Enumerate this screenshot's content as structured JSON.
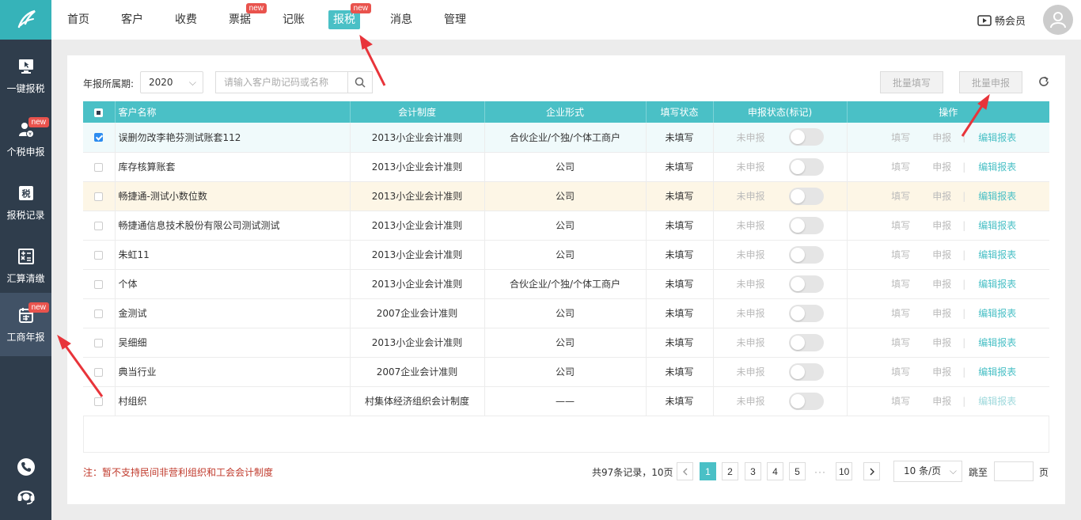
{
  "sidebar": {
    "items": [
      {
        "label": "一键报税",
        "icon": "monitor-cursor-icon",
        "badge": ""
      },
      {
        "label": "个税申报",
        "icon": "person-tax-icon",
        "badge": "new"
      },
      {
        "label": "报税记录",
        "icon": "tax-record-icon",
        "badge": ""
      },
      {
        "label": "汇算清缴",
        "icon": "calculator-icon",
        "badge": ""
      },
      {
        "label": "工商年报",
        "icon": "annual-report-icon",
        "badge": "new"
      }
    ],
    "bottom_icons": [
      "phone-icon",
      "headset-icon"
    ]
  },
  "topnav": {
    "items": [
      {
        "label": "首页",
        "badge": ""
      },
      {
        "label": "客户",
        "badge": ""
      },
      {
        "label": "收费",
        "badge": ""
      },
      {
        "label": "票据",
        "badge": "new"
      },
      {
        "label": "记账",
        "badge": ""
      },
      {
        "label": "报税",
        "badge": "new"
      },
      {
        "label": "消息",
        "badge": ""
      },
      {
        "label": "管理",
        "badge": ""
      }
    ],
    "member_label": "畅会员"
  },
  "filters": {
    "period_label": "年报所属期:",
    "year": "2020",
    "search_placeholder": "请输入客户助记码或名称"
  },
  "actions": {
    "batch_fill": "批量填写",
    "batch_declare": "批量申报"
  },
  "table": {
    "headers": {
      "name": "客户名称",
      "system": "会计制度",
      "form": "企业形式",
      "fill_status": "填写状态",
      "declare_status": "申报状态(标记)",
      "ops": "操作"
    },
    "op_labels": {
      "fill": "填写",
      "declare": "申报",
      "edit": "编辑报表"
    },
    "rows": [
      {
        "name": "误删勿改李艳芬测试账套112",
        "system": "2013小企业会计准则",
        "form": "合伙企业/个独/个体工商户",
        "fill": "未填写",
        "declare": "未申报"
      },
      {
        "name": "库存核算账套",
        "system": "2013小企业会计准则",
        "form": "公司",
        "fill": "未填写",
        "declare": "未申报"
      },
      {
        "name": "畅捷通-测试小数位数",
        "system": "2013小企业会计准则",
        "form": "公司",
        "fill": "未填写",
        "declare": "未申报"
      },
      {
        "name": "畅捷通信息技术股份有限公司测试测试",
        "system": "2013小企业会计准则",
        "form": "公司",
        "fill": "未填写",
        "declare": "未申报"
      },
      {
        "name": "朱虹11",
        "system": "2013小企业会计准则",
        "form": "公司",
        "fill": "未填写",
        "declare": "未申报"
      },
      {
        "name": "个体",
        "system": "2013小企业会计准则",
        "form": "合伙企业/个独/个体工商户",
        "fill": "未填写",
        "declare": "未申报"
      },
      {
        "name": "金测试",
        "system": "2007企业会计准则",
        "form": "公司",
        "fill": "未填写",
        "declare": "未申报"
      },
      {
        "name": "吴细细",
        "system": "2013小企业会计准则",
        "form": "公司",
        "fill": "未填写",
        "declare": "未申报"
      },
      {
        "name": "典当行业",
        "system": "2007企业会计准则",
        "form": "公司",
        "fill": "未填写",
        "declare": "未申报"
      },
      {
        "name": "村组织",
        "system": "村集体经济组织会计制度",
        "form": "——",
        "fill": "未填写",
        "declare": "未申报"
      }
    ]
  },
  "footer": {
    "note": "注：暂不支持民间非营利组织和工会会计制度",
    "total": "共97条记录，10页",
    "pages": [
      "1",
      "2",
      "3",
      "4",
      "5",
      "10"
    ],
    "dots": "···",
    "current_page": "1",
    "per_page": "10 条/页",
    "jump_label": "跳至",
    "page_suffix": "页"
  },
  "colors": {
    "accent": "#4ac0c6",
    "sidebar": "#2f3d4c",
    "badge": "#e9534d",
    "note": "#c0392b"
  }
}
